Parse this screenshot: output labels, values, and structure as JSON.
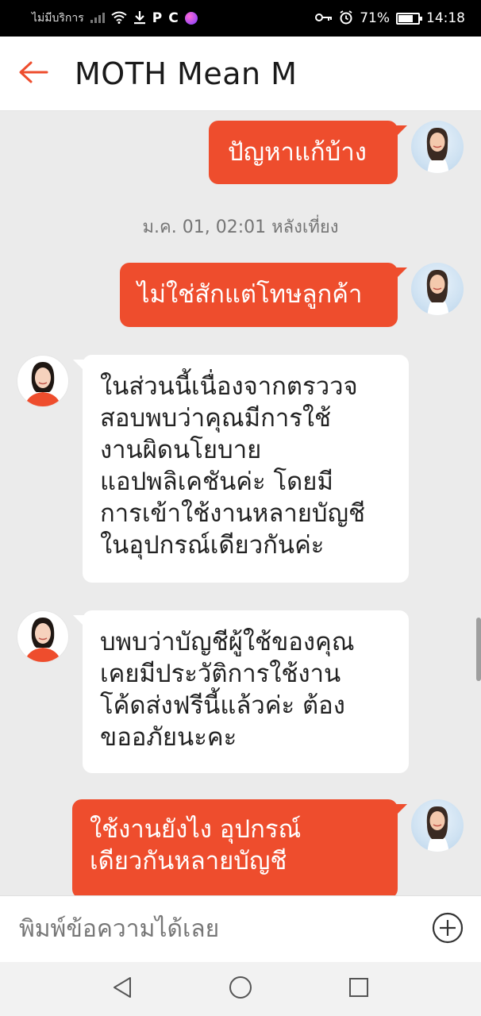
{
  "status_bar": {
    "carrier": "ไม่มีบริการ",
    "battery_percent": "71%",
    "battery_level": 0.71,
    "time": "14:18",
    "icons": [
      "no-signal-icon",
      "wifi-icon",
      "download-icon",
      "p-app-icon",
      "c-app-icon",
      "app-badge-icon",
      "key-icon",
      "alarm-icon",
      "battery-icon"
    ]
  },
  "header": {
    "back_icon": "back-arrow-icon",
    "title": "MOTH Mean M"
  },
  "messages": [
    {
      "id": "m1",
      "sender": "user",
      "lines": [
        "ปัญหาแก้บ้าง"
      ]
    },
    {
      "id": "ts1",
      "type": "timestamp",
      "text": "ม.ค. 01, 02:01 หลังเที่ยง"
    },
    {
      "id": "m2",
      "sender": "user",
      "lines": [
        "ไม่ใช่สักแต่โทษลูกค้า"
      ]
    },
    {
      "id": "m3",
      "sender": "agent",
      "lines": [
        "ในส่วนนี้เนื่องจากตรววจ",
        "สอบพบว่าคุณมีการใช้",
        "งานผิดนโยบาย",
        "แอปพลิเคชันค่ะ โดยมี",
        "การเข้าใช้งานหลายบัญชี",
        "ในอุปกรณ์เดียวกันค่ะ"
      ]
    },
    {
      "id": "m4",
      "sender": "agent",
      "lines": [
        "บพบว่าบัญชีผู้ใช้ของคุณ",
        "เคยมีประวัติการใช้งาน",
        "โค้ดส่งฟรีนี้แล้วค่ะ ต้อง",
        "ขออภัยนะคะ"
      ]
    },
    {
      "id": "m5",
      "sender": "user",
      "lines": [
        "ใช้งานยังไง อุปกรณ์",
        "เดียวกันหลายบัญชี"
      ]
    }
  ],
  "input": {
    "placeholder": "พิมพ์ข้อความได้เลย",
    "value": "",
    "add_icon": "plus-circle-icon"
  },
  "nav": [
    "back-triangle-icon",
    "home-circle-icon",
    "recents-square-icon"
  ],
  "colors": {
    "accent": "#ee4d2d",
    "background": "#ebebeb",
    "incoming_bubble": "#ffffff",
    "outgoing_text": "#ffffff"
  }
}
